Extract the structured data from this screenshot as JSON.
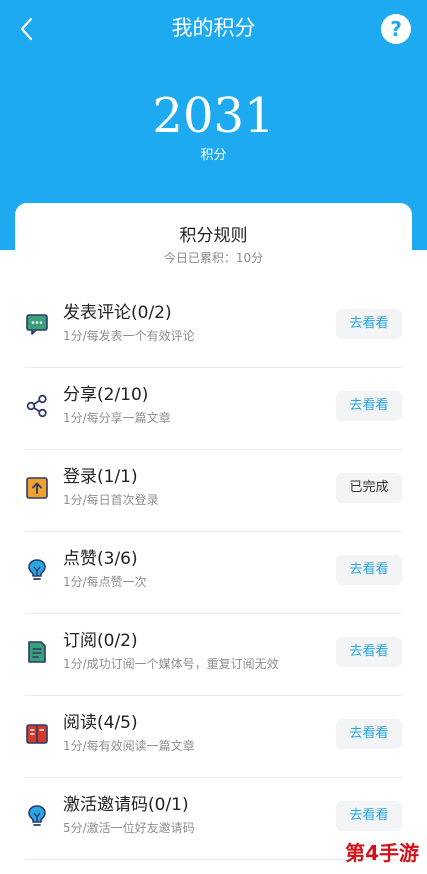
{
  "header": {
    "title": "我的积分",
    "points": "2031",
    "points_label": "积分",
    "help_label": "?"
  },
  "rules": {
    "title": "积分规则",
    "today_summary": "今日已累积：10分"
  },
  "tasks": [
    {
      "title": "发表评论(0/2)",
      "desc": "1分/每发表一个有效评论",
      "action": "去看看",
      "icon": "comment-icon",
      "done": false
    },
    {
      "title": "分享(2/10)",
      "desc": "1分/每分享一篇文章",
      "action": "去看看",
      "icon": "share-icon",
      "done": false
    },
    {
      "title": "登录(1/1)",
      "desc": "1分/每日首次登录",
      "action": "已完成",
      "icon": "login-icon",
      "done": true
    },
    {
      "title": "点赞(3/6)",
      "desc": "1分/每点赞一次",
      "action": "去看看",
      "icon": "bulb-icon",
      "done": false
    },
    {
      "title": "订阅(0/2)",
      "desc": "1分/成功订阅一个媒体号，重复订阅无效",
      "action": "去看看",
      "icon": "document-icon",
      "done": false
    },
    {
      "title": "阅读(4/5)",
      "desc": "1分/每有效阅读一篇文章",
      "action": "去看看",
      "icon": "book-icon",
      "done": false
    },
    {
      "title": "激活邀请码(0/1)",
      "desc": "5分/激活一位好友邀请码",
      "action": "去看看",
      "icon": "bulb-icon",
      "done": false
    }
  ],
  "watermark": "第4手游",
  "colors": {
    "header_bg": "#1eaaf0",
    "action_text": "#29a6e3",
    "icon_green": "#3aa07a",
    "icon_orange": "#f0a030",
    "icon_red": "#d23a2a",
    "icon_navy": "#2b3a6b"
  }
}
